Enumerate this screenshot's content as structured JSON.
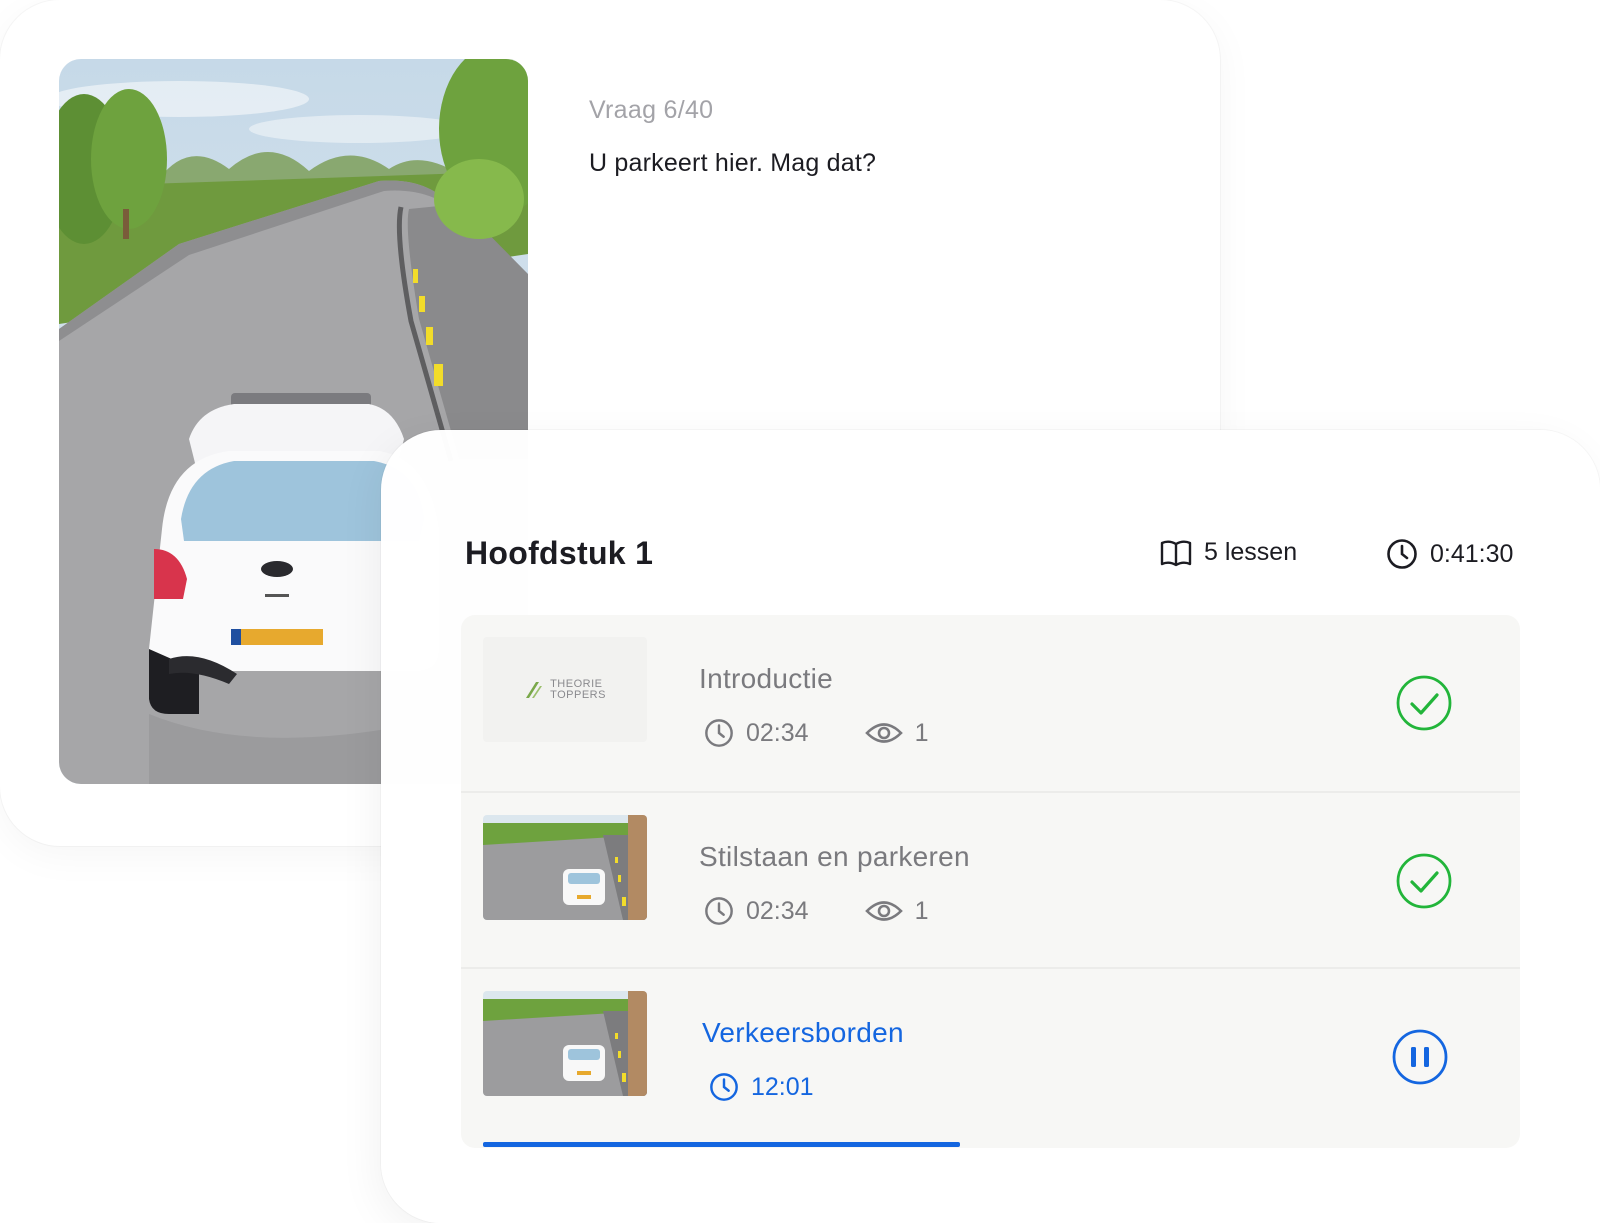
{
  "question": {
    "counter": "Vraag 6/40",
    "text": "U parkeert hier. Mag dat?"
  },
  "chapter": {
    "title": "Hoofdstuk 1",
    "lessons_count": "5 lessen",
    "total_duration": "0:41:30"
  },
  "lessons": [
    {
      "title": "Introductie",
      "duration": "02:34",
      "views": "1",
      "thumbnail": "theorie-toppers-logo",
      "logo_line1": "THEORIE",
      "logo_line2": "TOPPERS",
      "status": "completed"
    },
    {
      "title": "Stilstaan en parkeren",
      "duration": "02:34",
      "views": "1",
      "thumbnail": "road-scene",
      "status": "completed"
    },
    {
      "title": "Verkeersborden",
      "duration": "12:01",
      "thumbnail": "road-scene",
      "status": "playing",
      "progress": 0.46
    }
  ],
  "colors": {
    "accent": "#1466e0",
    "success": "#22b53a",
    "muted_text": "#7a7a7e"
  }
}
